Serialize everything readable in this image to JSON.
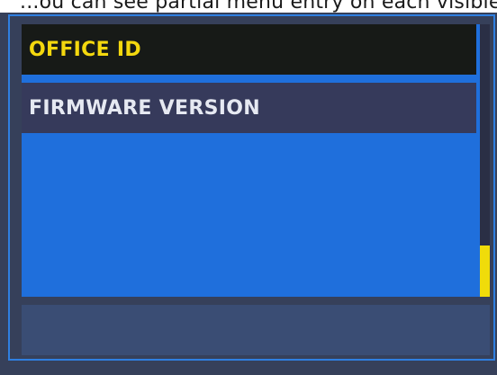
{
  "header": {
    "cutoff_text": "...ou can see partial menu entry on each visible menu entry..."
  },
  "menu": {
    "items": [
      {
        "label": "OFFICE ID",
        "selected": true
      },
      {
        "label": "FIRMWARE VERSION",
        "selected": false
      }
    ]
  },
  "scrollbar": {
    "position_fraction": 1.0
  },
  "colors": {
    "background": "#36405a",
    "list_background": "#1f6fdc",
    "panel_border": "#2f7fe0",
    "selected_background": "#171a17",
    "selected_text": "#f4d80e",
    "item_background": "#363a5b",
    "item_text": "#e6e9f2",
    "scroll_thumb": "#f0dc0a",
    "footer": "#3a4d74"
  }
}
